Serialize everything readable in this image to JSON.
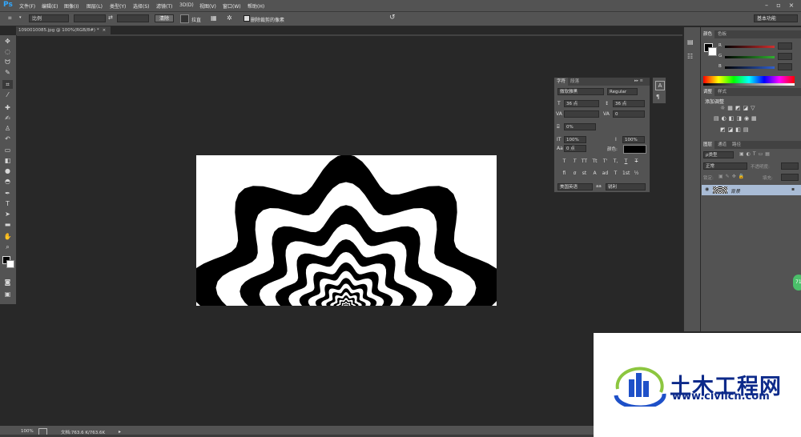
{
  "app": {
    "logo": "Ps"
  },
  "menu": [
    "文件(F)",
    "编辑(E)",
    "图像(I)",
    "图层(L)",
    "类型(Y)",
    "选择(S)",
    "滤镜(T)",
    "3D(D)",
    "视图(V)",
    "窗口(W)",
    "帮助(H)"
  ],
  "options_bar": {
    "ratio_select": "比例",
    "clear_button": "清除",
    "straighten_label": "拉直",
    "delete_cropped_label": "删除裁剪的像素",
    "workspace_select": "基本功能"
  },
  "document_tab": {
    "title": "1090010085.jpg @ 100%(RGB/8#) *"
  },
  "status_bar": {
    "zoom": "100%",
    "doc_size": "文档:763.6 K/763.6K"
  },
  "color_panel": {
    "tabs": [
      "颜色",
      "色板"
    ],
    "channels": [
      {
        "label": "R",
        "value": "",
        "color": "#d03030"
      },
      {
        "label": "G",
        "value": "",
        "color": "#30b030"
      },
      {
        "label": "B",
        "value": "",
        "color": "#3060d0"
      }
    ]
  },
  "adjustments_panel": {
    "tabs": [
      "调整",
      "样式"
    ],
    "title": "添加调整"
  },
  "layers_panel": {
    "tabs": [
      "图层",
      "通道",
      "路径"
    ],
    "kind_select": "ρ类型",
    "blend_mode": "正常",
    "opacity_label": "不透明度:",
    "lock_label": "锁定:",
    "fill_label": "填充:",
    "layer_name": "背景"
  },
  "character_panel": {
    "tabs": [
      "字符",
      "段落"
    ],
    "font_family": "微软雅黑",
    "font_style": "Regular",
    "font_size": "36 点",
    "leading": "36 点",
    "kerning": "",
    "tracking": "0",
    "vertical_scale_pct": "0%",
    "horizontal_scale": "100%",
    "vertical_scale": "100%",
    "baseline_shift": "0 点",
    "color_label": "颜色:",
    "language": "美国英语",
    "antialias_label": "aa",
    "antialias": "锐利",
    "format_buttons": [
      "T",
      "T",
      "TT",
      "Tt",
      "T'",
      "T,",
      "T",
      "T"
    ],
    "opentype_buttons": [
      "fi",
      "σ",
      "st",
      "A",
      "ad",
      "T",
      "1st",
      "½"
    ]
  },
  "watermark": {
    "title": "土木工程网",
    "url": "www.civilcn.com"
  },
  "badge": {
    "text": "71"
  }
}
